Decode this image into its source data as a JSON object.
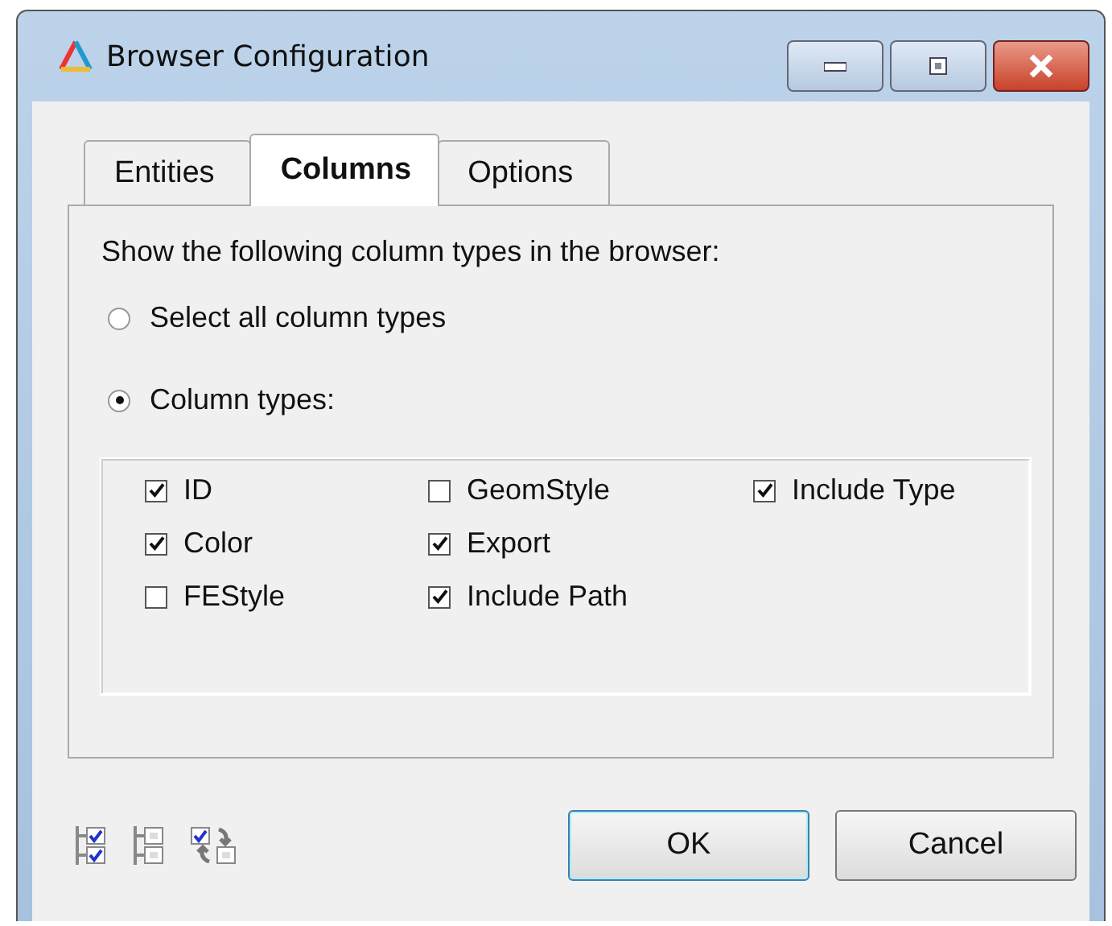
{
  "window": {
    "title": "Browser Configuration"
  },
  "tabs": [
    {
      "label": "Entities",
      "selected": false
    },
    {
      "label": "Columns",
      "selected": true
    },
    {
      "label": "Options",
      "selected": false
    }
  ],
  "prompt": "Show the following column types in the browser:",
  "radios": [
    {
      "label": "Select all column types",
      "selected": false
    },
    {
      "label": "Column types:",
      "selected": true
    }
  ],
  "column_types": [
    [
      {
        "label": "ID",
        "checked": true
      },
      {
        "label": "Color",
        "checked": true
      },
      {
        "label": "FEStyle",
        "checked": false
      }
    ],
    [
      {
        "label": "GeomStyle",
        "checked": false
      },
      {
        "label": "Export",
        "checked": true
      },
      {
        "label": "Include Path",
        "checked": true
      }
    ],
    [
      {
        "label": "Include Type",
        "checked": true
      }
    ]
  ],
  "buttons": [
    "OK",
    "Cancel"
  ]
}
